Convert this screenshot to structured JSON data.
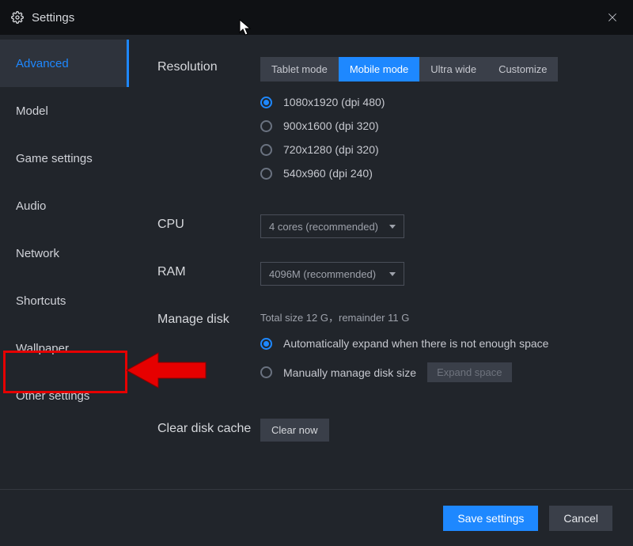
{
  "title": "Settings",
  "sidebar": {
    "items": [
      {
        "label": "Advanced"
      },
      {
        "label": "Model"
      },
      {
        "label": "Game settings"
      },
      {
        "label": "Audio"
      },
      {
        "label": "Network"
      },
      {
        "label": "Shortcuts"
      },
      {
        "label": "Wallpaper"
      },
      {
        "label": "Other settings"
      }
    ]
  },
  "resolution": {
    "label": "Resolution",
    "tabs": [
      {
        "label": "Tablet mode"
      },
      {
        "label": "Mobile mode"
      },
      {
        "label": "Ultra wide"
      },
      {
        "label": "Customize"
      }
    ],
    "options": [
      {
        "label": "1080x1920  (dpi 480)"
      },
      {
        "label": "900x1600  (dpi 320)"
      },
      {
        "label": "720x1280  (dpi 320)"
      },
      {
        "label": "540x960  (dpi 240)"
      }
    ]
  },
  "cpu": {
    "label": "CPU",
    "selected": "4 cores (recommended)"
  },
  "ram": {
    "label": "RAM",
    "selected": "4096M (recommended)"
  },
  "disk": {
    "label": "Manage disk",
    "info": "Total size 12 G，remainder 11 G",
    "opt_auto": "Automatically expand when there is not enough space",
    "opt_manual": "Manually manage disk size",
    "expand_btn": "Expand space"
  },
  "cache": {
    "label": "Clear disk cache",
    "btn": "Clear now"
  },
  "footer": {
    "save": "Save settings",
    "cancel": "Cancel"
  }
}
